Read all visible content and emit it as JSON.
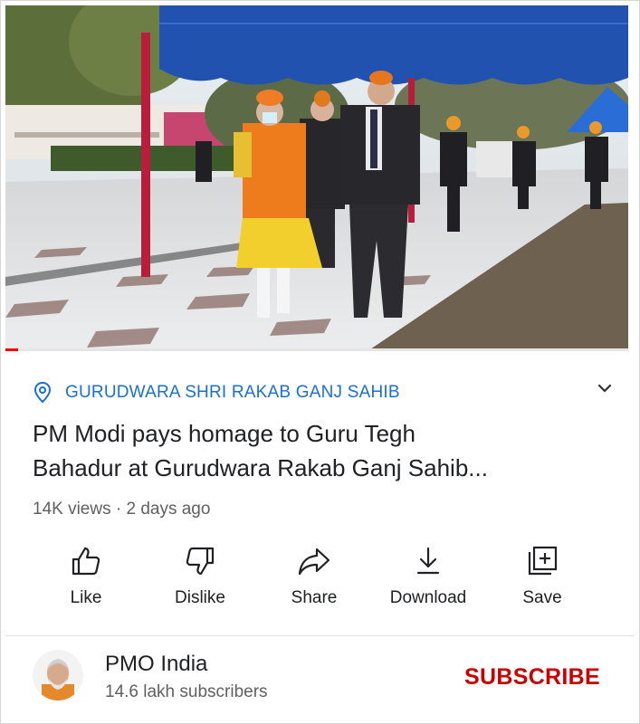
{
  "video": {
    "progress": 0.02,
    "colors": {
      "progress": "#ff0000",
      "canopy": "#2152b0"
    }
  },
  "location": {
    "icon": "location-pin-icon",
    "label": "GURUDWARA SHRI RAKAB GANJ SAHIB"
  },
  "title": {
    "line1": "PM Modi pays homage to Guru Tegh",
    "line2": "Bahadur at Gurudwara Rakab Ganj Sahib..."
  },
  "meta": "14K views · 2 days ago",
  "actions": [
    {
      "label": "Like",
      "icon": "thumbs-up-icon"
    },
    {
      "label": "Dislike",
      "icon": "thumbs-down-icon"
    },
    {
      "label": "Share",
      "icon": "share-arrow-icon"
    },
    {
      "label": "Download",
      "icon": "download-icon"
    },
    {
      "label": "Save",
      "icon": "add-to-playlist-icon"
    }
  ],
  "channel": {
    "name": "PMO India",
    "subscribers": "14.6 lakh subscribers",
    "subscribe_label": "SUBSCRIBE",
    "subscribe_color": "#cc0000"
  }
}
